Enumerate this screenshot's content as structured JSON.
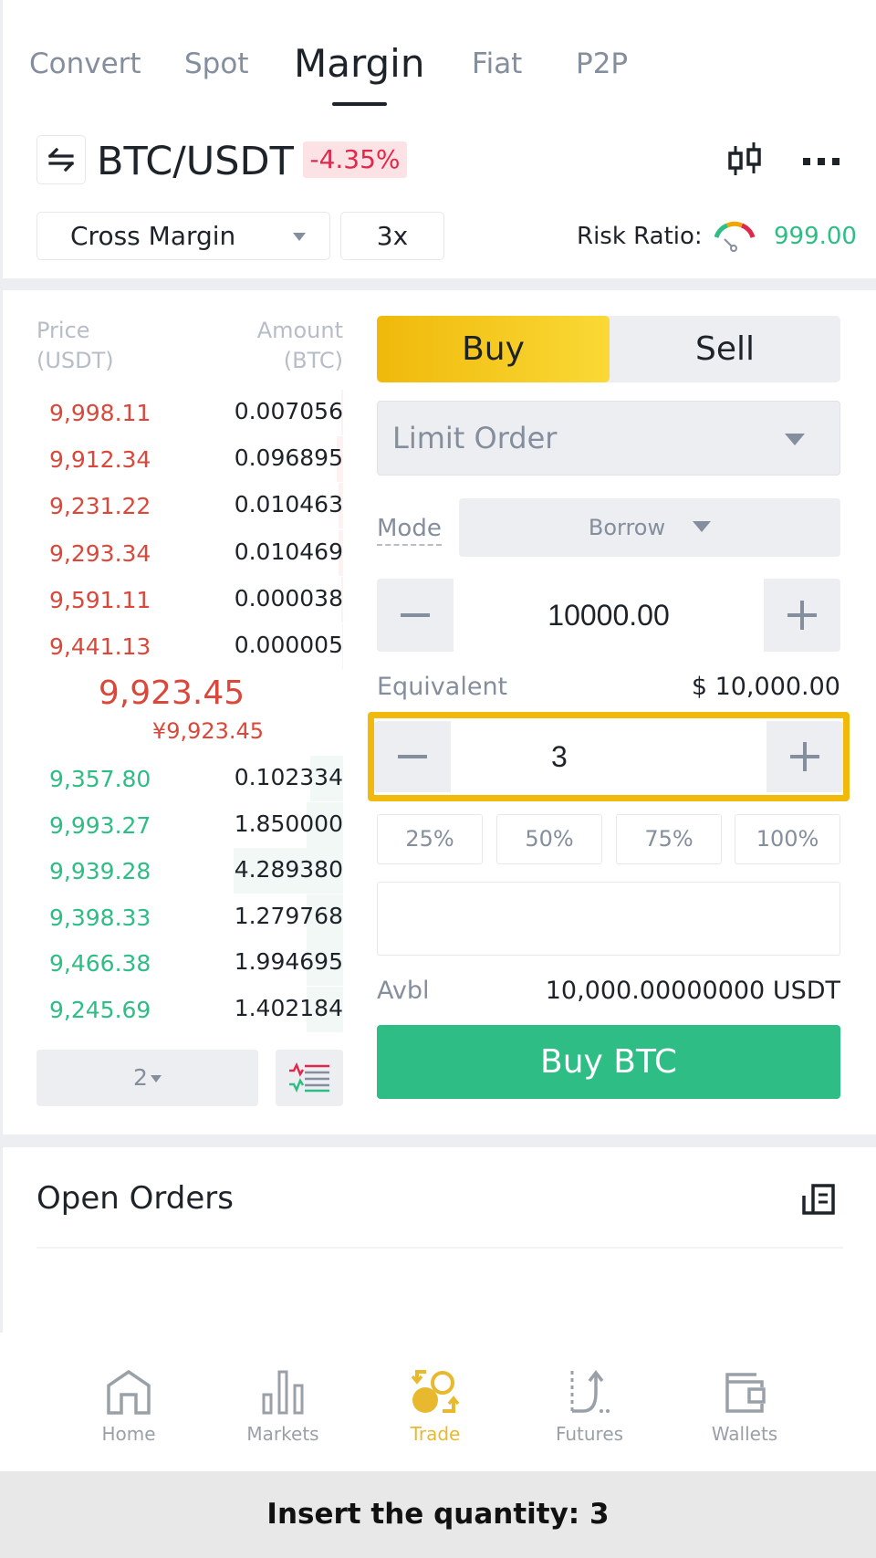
{
  "tabs": [
    {
      "label": "Convert",
      "active": false
    },
    {
      "label": "Spot",
      "active": false
    },
    {
      "label": "Margin",
      "active": true
    },
    {
      "label": "Fiat",
      "active": false
    },
    {
      "label": "P2P",
      "active": false
    }
  ],
  "pair": {
    "symbol": "BTC/USDT",
    "change": "-4.35%",
    "swap_icon": "swap-arrows-icon",
    "chart_icon": "candlestick-icon",
    "more_icon": "more-dots-icon"
  },
  "margin": {
    "mode": "Cross Margin",
    "leverage": "3x",
    "risk_label": "Risk Ratio:",
    "risk_value": "999.00"
  },
  "orderbook": {
    "price_header": [
      "Price",
      "(USDT)"
    ],
    "amount_header": [
      "Amount",
      "(BTC)"
    ],
    "asks": [
      {
        "price": "9,998.11",
        "amount": "0.007056",
        "depth": 0.02
      },
      {
        "price": "9,912.34",
        "amount": "0.096895",
        "depth": 0.06
      },
      {
        "price": "9,231.22",
        "amount": "0.010463",
        "depth": 0.04
      },
      {
        "price": "9,293.34",
        "amount": "0.010469",
        "depth": 0.04
      },
      {
        "price": "9,591.11",
        "amount": "0.000038",
        "depth": 0.02
      },
      {
        "price": "9,441.13",
        "amount": "0.000005",
        "depth": 0.01
      }
    ],
    "mid_price": "9,923.45",
    "mid_price_cny": "¥9,923.45",
    "bids": [
      {
        "price": "9,357.80",
        "amount": "0.102334",
        "depth": 0.3
      },
      {
        "price": "9,993.27",
        "amount": "1.850000",
        "depth": 0.33
      },
      {
        "price": "9,939.28",
        "amount": "4.289380",
        "depth": 1.0
      },
      {
        "price": "9,398.33",
        "amount": "1.279768",
        "depth": 0.33
      },
      {
        "price": "9,466.38",
        "amount": "1.994695",
        "depth": 0.33
      },
      {
        "price": "9,245.69",
        "amount": "1.402184",
        "depth": 0.33
      }
    ],
    "decimals": "2",
    "view_icon": "orderbook-view-icon"
  },
  "form": {
    "buy_label": "Buy",
    "sell_label": "Sell",
    "order_type": "Limit Order",
    "mode_label": "Mode",
    "mode_value": "Borrow",
    "price_value": "10000.00",
    "equivalent_label": "Equivalent",
    "equivalent_value": "$ 10,000.00",
    "quantity_value": "3",
    "percent_options": [
      "25%",
      "50%",
      "75%",
      "100%"
    ],
    "total_value": "",
    "avbl_label": "Avbl",
    "avbl_value": "10,000.00000000 USDT",
    "submit_label": "Buy BTC"
  },
  "open_orders": {
    "title": "Open Orders",
    "icon": "order-history-icon"
  },
  "nav": [
    {
      "label": "Home",
      "icon": "home-icon",
      "active": false
    },
    {
      "label": "Markets",
      "icon": "markets-icon",
      "active": false
    },
    {
      "label": "Trade",
      "icon": "trade-icon",
      "active": true
    },
    {
      "label": "Futures",
      "icon": "futures-icon",
      "active": false
    },
    {
      "label": "Wallets",
      "icon": "wallet-icon",
      "active": false
    }
  ],
  "caption": "Insert the quantity: 3",
  "colors": {
    "accent": "#f0b90b",
    "buy": "#2ebd85",
    "sell": "#d9483b",
    "change_negative": "#e0294a"
  }
}
